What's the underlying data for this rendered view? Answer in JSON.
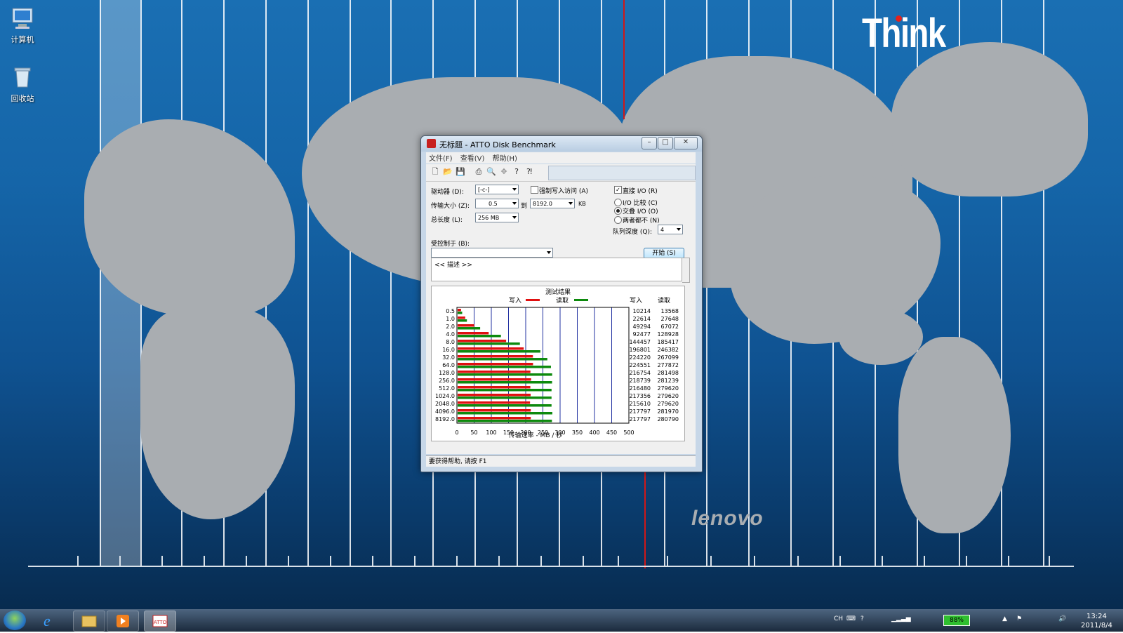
{
  "desktop": {
    "icons": [
      {
        "label": "计算机",
        "icon": "computer-icon"
      },
      {
        "label": "回收站",
        "icon": "recycle-bin-icon"
      }
    ],
    "brand_think": "Think",
    "brand_lenovo": "lenovo"
  },
  "window": {
    "title": "无标题 - ATTO Disk Benchmark",
    "menu": [
      "文件(F)",
      "查看(V)",
      "帮助(H)"
    ],
    "toolbar_icons": [
      "new-icon",
      "open-icon",
      "save-icon",
      "print-icon",
      "print-preview-icon",
      "move-icon",
      "help-icon",
      "context-help-icon"
    ],
    "form": {
      "drive_label": "驱动器 (D):",
      "drive_value": "[-c-]",
      "force_write_label": "强制写入访问 (A)",
      "force_write_checked": false,
      "direct_io_label": "直接 I/O (R)",
      "direct_io_checked": true,
      "transfer_label": "传输大小 (Z):",
      "transfer_from": "0.5",
      "transfer_to_label": "到",
      "transfer_to": "8192.0",
      "transfer_unit": "KB",
      "io_compare_label": "I/O 比较 (C)",
      "overlap_io_label": "交叠 I/O (O)",
      "neither_label": "两者都不 (N)",
      "selected_io_mode": "overlap",
      "total_length_label": "总长度 (L):",
      "total_length_value": "256 MB",
      "queue_depth_label": "队列深度 (Q):",
      "queue_depth_value": "4",
      "controlled_by_label": "受控制于 (B):",
      "controlled_by_value": "",
      "start_button": "开始 (S)",
      "description": "<< 描述 >>"
    },
    "results": {
      "title": "测试结果",
      "write_label": "写入",
      "read_label": "读取",
      "xaxis_label": "传输速率 - MB / 秒"
    },
    "status": "要获得帮助, 请按 F1"
  },
  "chart_data": {
    "type": "bar",
    "title": "测试结果",
    "xlabel": "传输速率 - MB / 秒",
    "xlim": [
      0,
      500
    ],
    "xticks": [
      0,
      50,
      100,
      150,
      200,
      250,
      300,
      350,
      400,
      450,
      500
    ],
    "categories": [
      "0.5",
      "1.0",
      "2.0",
      "4.0",
      "8.0",
      "16.0",
      "32.0",
      "64.0",
      "128.0",
      "256.0",
      "512.0",
      "1024.0",
      "2048.0",
      "4096.0",
      "8192.0"
    ],
    "series": [
      {
        "name": "写入",
        "color": "#e01010",
        "values": [
          10214,
          22614,
          49294,
          92477,
          144457,
          196801,
          224220,
          224551,
          216754,
          218739,
          216480,
          217356,
          215610,
          217797,
          217797
        ]
      },
      {
        "name": "读取",
        "color": "#0d8a0d",
        "values": [
          13568,
          27648,
          67072,
          128928,
          185417,
          246382,
          267099,
          277872,
          281498,
          281239,
          279620,
          279620,
          279620,
          281970,
          280790
        ]
      }
    ],
    "value_unit_scale": 1024
  },
  "taskbar": {
    "language": "CH",
    "battery": "88%",
    "time": "13:24",
    "date": "2011/8/4"
  }
}
